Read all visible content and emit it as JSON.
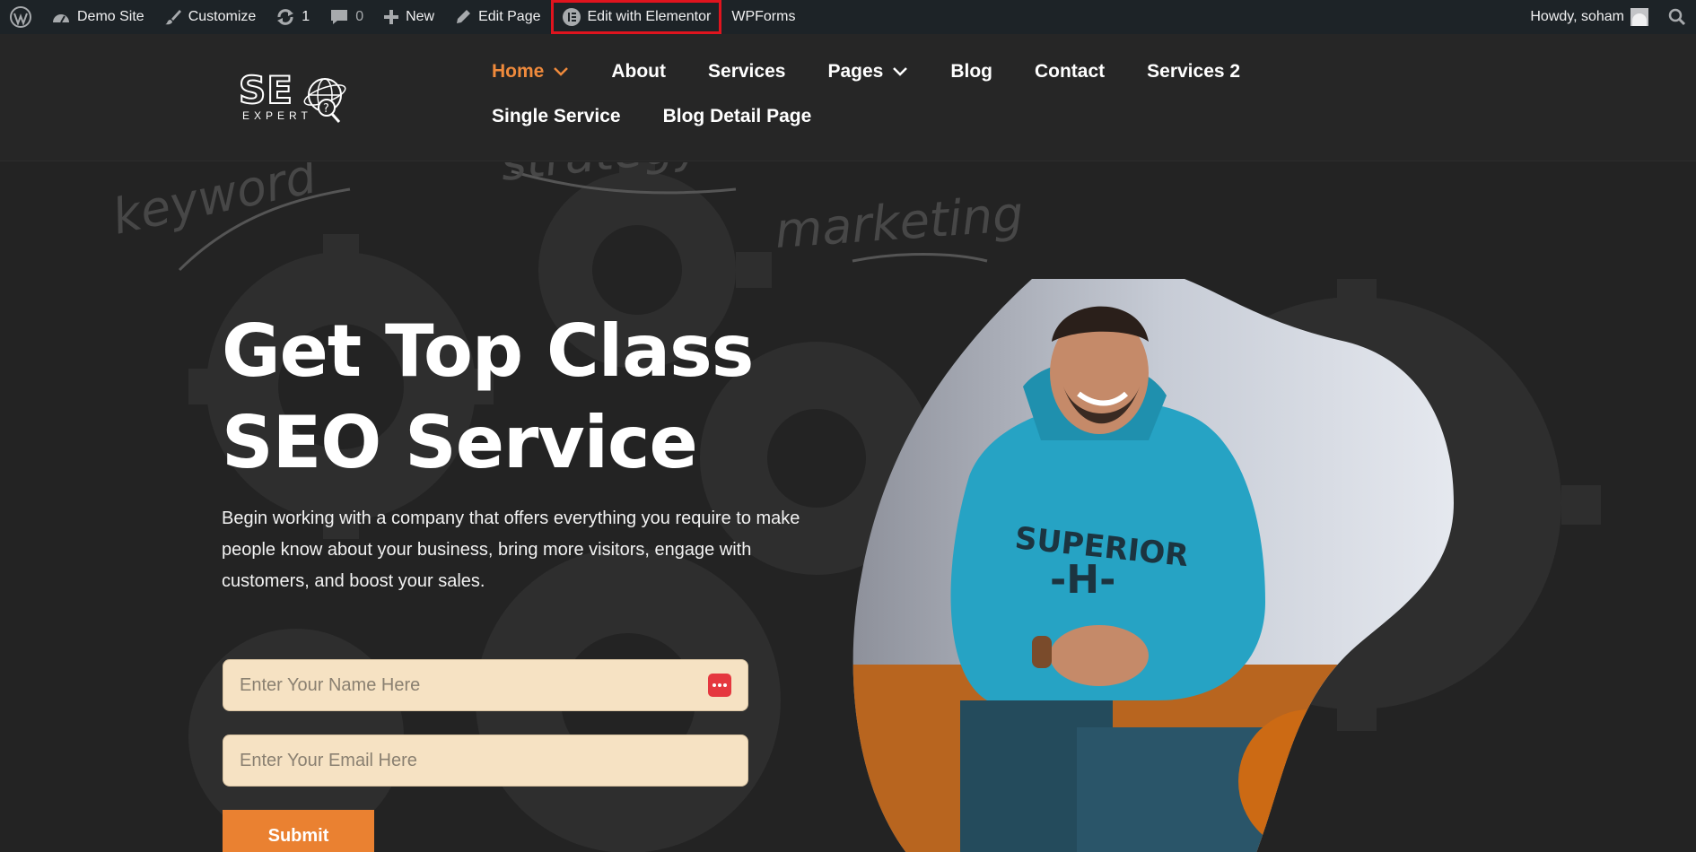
{
  "adminbar": {
    "wp_logo_icon": "wordpress-icon",
    "site_name": "Demo Site",
    "customize": "Customize",
    "updates_count": "1",
    "comments_count": "0",
    "new": "New",
    "edit_page": "Edit Page",
    "edit_elementor": "Edit with Elementor",
    "wpforms": "WPForms",
    "howdy": "Howdy, soham",
    "highlight_color": "#e0141e"
  },
  "logo": {
    "mark": "SE",
    "sub": "EXPERT"
  },
  "nav": {
    "items": [
      {
        "label": "Home",
        "active": true,
        "has_dropdown": true
      },
      {
        "label": "About"
      },
      {
        "label": "Services"
      },
      {
        "label": "Pages",
        "has_dropdown": true
      },
      {
        "label": "Blog"
      },
      {
        "label": "Contact"
      },
      {
        "label": "Services 2"
      },
      {
        "label": "Single Service"
      },
      {
        "label": "Blog Detail Page"
      }
    ],
    "active_color": "#ef8a3c"
  },
  "hero": {
    "headline_line1": "Get Top Class",
    "headline_line2": "SEO Service",
    "lead_line1": "Begin working with a company that offers everything you require to make",
    "lead_line2": "people know about your business, bring more visitors, engage with",
    "lead_line3": "customers, and boost your sales.",
    "name_placeholder": "Enter Your Name Here",
    "email_placeholder": "Enter Your Email Here",
    "submit": "Submit",
    "accent": "#ea8131",
    "field_bg": "#f6e2c3"
  }
}
